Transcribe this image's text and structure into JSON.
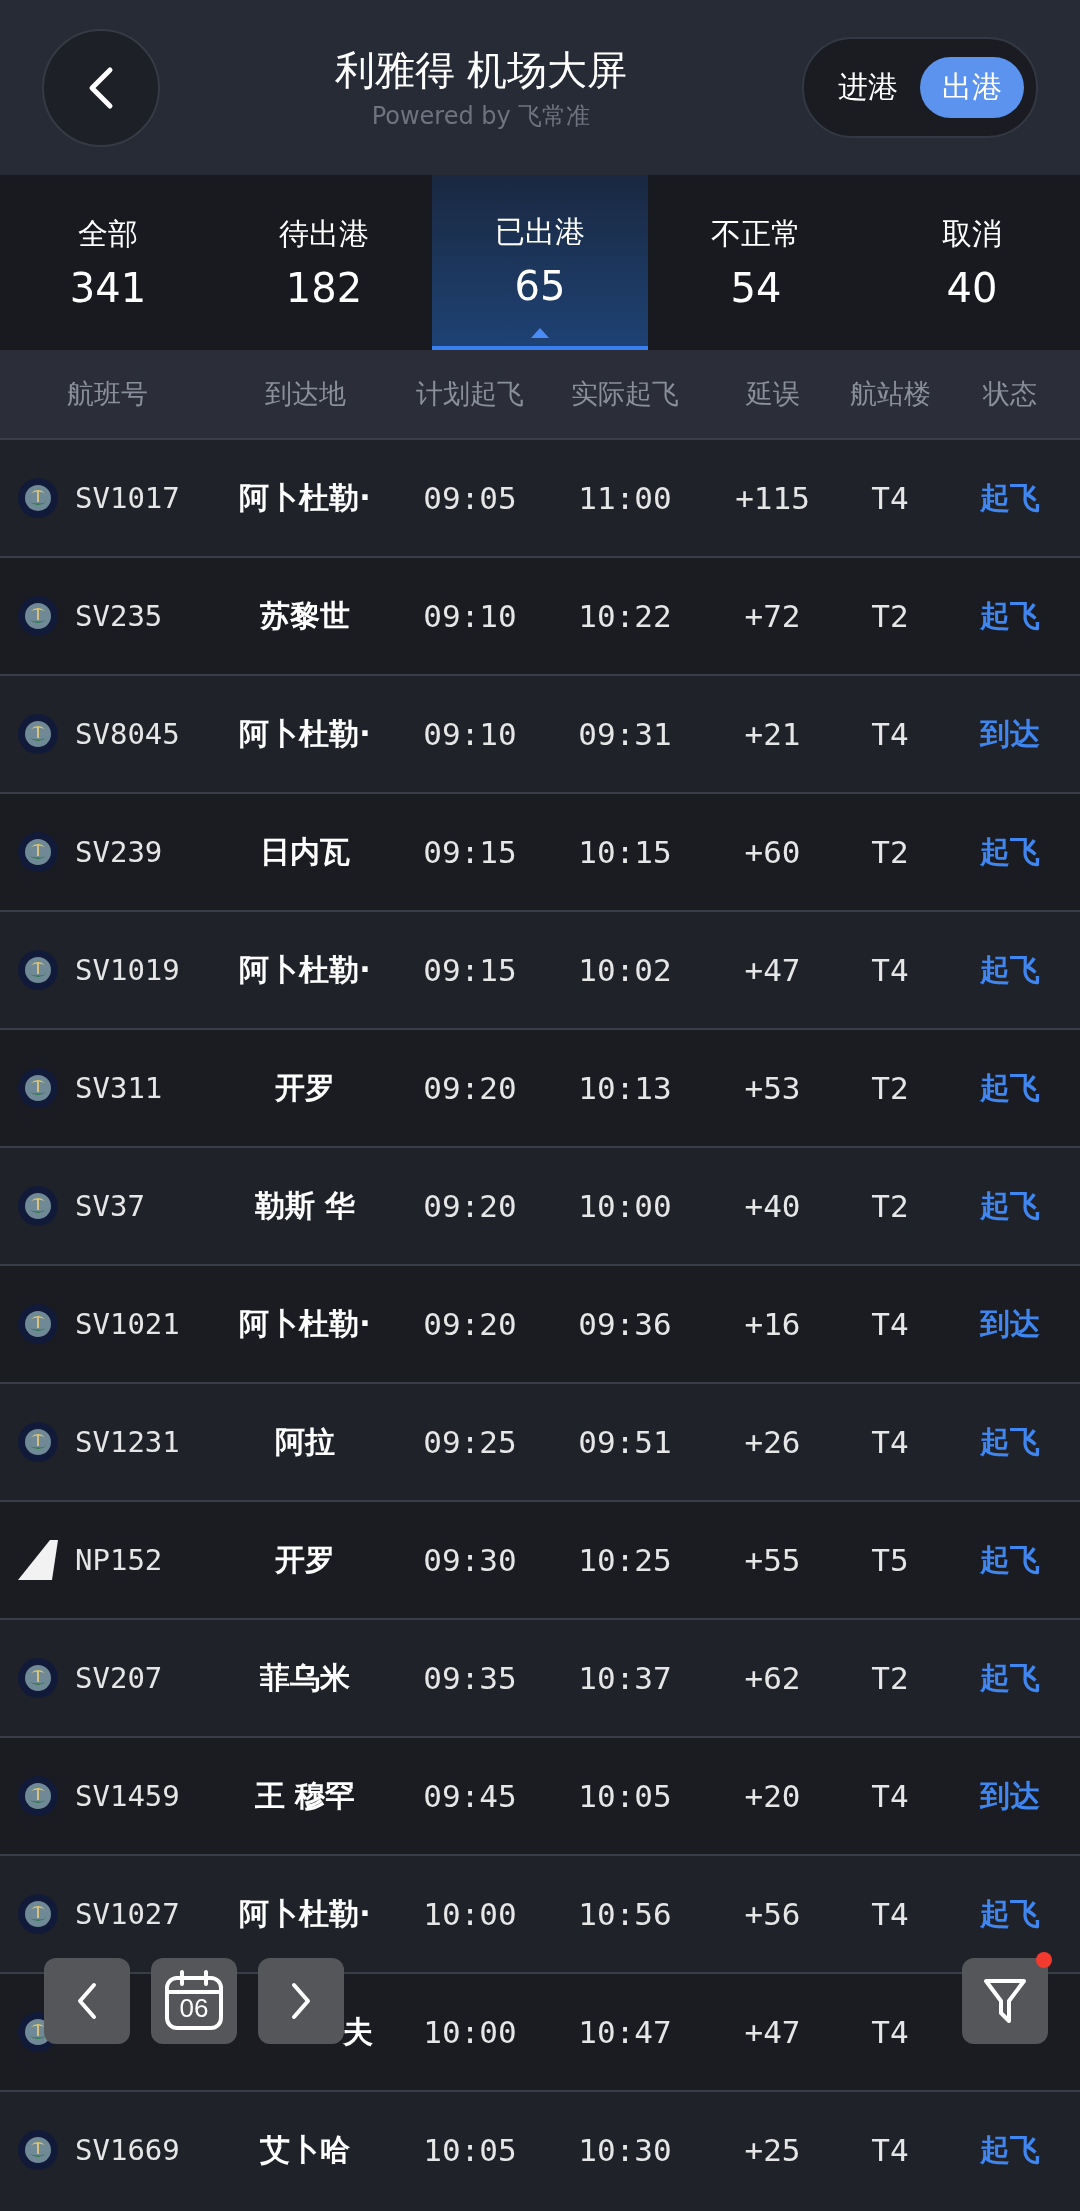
{
  "header": {
    "title": "利雅得 机场大屏",
    "subtitle": "Powered by 飞常准",
    "toggle": [
      {
        "label": "进港",
        "selected": false
      },
      {
        "label": "出港",
        "selected": true
      }
    ]
  },
  "tabs": [
    {
      "label": "全部",
      "count": "341",
      "selected": false
    },
    {
      "label": "待出港",
      "count": "182",
      "selected": false
    },
    {
      "label": "已出港",
      "count": "65",
      "selected": true
    },
    {
      "label": "不正常",
      "count": "54",
      "selected": false
    },
    {
      "label": "取消",
      "count": "40",
      "selected": false
    }
  ],
  "columns": [
    "航班号",
    "到达地",
    "计划起飞",
    "实际起飞",
    "延误",
    "航站楼",
    "状态"
  ],
  "rows": [
    {
      "kind": "round",
      "flight": "SV1017",
      "destination": "阿卜杜勒·",
      "planned": "09:05",
      "actual": "11:00",
      "delay": "+115",
      "terminal": "T4",
      "status": "起飞"
    },
    {
      "kind": "round",
      "flight": "SV235",
      "destination": "苏黎世",
      "planned": "09:10",
      "actual": "10:22",
      "delay": "+72",
      "terminal": "T2",
      "status": "起飞"
    },
    {
      "kind": "round",
      "flight": "SV8045",
      "destination": "阿卜杜勒·",
      "planned": "09:10",
      "actual": "09:31",
      "delay": "+21",
      "terminal": "T4",
      "status": "到达"
    },
    {
      "kind": "round",
      "flight": "SV239",
      "destination": "日内瓦",
      "planned": "09:15",
      "actual": "10:15",
      "delay": "+60",
      "terminal": "T2",
      "status": "起飞"
    },
    {
      "kind": "round",
      "flight": "SV1019",
      "destination": "阿卜杜勒·",
      "planned": "09:15",
      "actual": "10:02",
      "delay": "+47",
      "terminal": "T4",
      "status": "起飞"
    },
    {
      "kind": "round",
      "flight": "SV311",
      "destination": "开罗",
      "planned": "09:20",
      "actual": "10:13",
      "delay": "+53",
      "terminal": "T2",
      "status": "起飞"
    },
    {
      "kind": "round",
      "flight": "SV37",
      "destination": "勒斯 华",
      "planned": "09:20",
      "actual": "10:00",
      "delay": "+40",
      "terminal": "T2",
      "status": "起飞"
    },
    {
      "kind": "round",
      "flight": "SV1021",
      "destination": "阿卜杜勒·",
      "planned": "09:20",
      "actual": "09:36",
      "delay": "+16",
      "terminal": "T4",
      "status": "到达"
    },
    {
      "kind": "round",
      "flight": "SV1231",
      "destination": "阿拉",
      "planned": "09:25",
      "actual": "09:51",
      "delay": "+26",
      "terminal": "T4",
      "status": "起飞"
    },
    {
      "kind": "tail",
      "flight": "NP152",
      "destination": "开罗",
      "planned": "09:30",
      "actual": "10:25",
      "delay": "+55",
      "terminal": "T5",
      "status": "起飞"
    },
    {
      "kind": "round",
      "flight": "SV207",
      "destination": "菲乌米",
      "planned": "09:35",
      "actual": "10:37",
      "delay": "+62",
      "terminal": "T2",
      "status": "起飞"
    },
    {
      "kind": "round",
      "flight": "SV1459",
      "destination": "王 穆罕",
      "planned": "09:45",
      "actual": "10:05",
      "delay": "+20",
      "terminal": "T4",
      "status": "到达"
    },
    {
      "kind": "round",
      "flight": "SV1027",
      "destination": "阿卜杜勒·",
      "planned": "10:00",
      "actual": "10:56",
      "delay": "+56",
      "terminal": "T4",
      "status": "起飞"
    },
    {
      "kind": "round",
      "destination": "夫",
      "planned": "10:00",
      "actual": "10:47",
      "delay": "+47",
      "terminal": "T4"
    },
    {
      "kind": "round",
      "flight": "SV1669",
      "destination": "艾卜哈",
      "planned": "10:05",
      "actual": "10:30",
      "delay": "+25",
      "terminal": "T4",
      "status": "起飞"
    }
  ],
  "date_nav": {
    "day": "06"
  },
  "filter": {
    "badge": true
  }
}
